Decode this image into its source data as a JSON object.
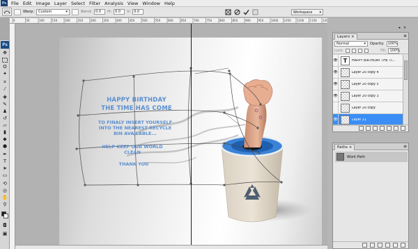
{
  "app": {
    "logo": "Ps"
  },
  "menu": [
    "File",
    "Edit",
    "Image",
    "Layer",
    "Select",
    "Filter",
    "Analysis",
    "View",
    "Window",
    "Help"
  ],
  "options": {
    "warp_label": "Warp:",
    "warp_value": "Custom",
    "bend_label": "Bend:",
    "bend_value": "0.0",
    "h_label": "H:",
    "h_value": "0.0",
    "v_label": "V:",
    "v_value": "0.0",
    "workspace": "Workspace"
  },
  "ruler_ticks": [
    "0",
    "50",
    "100",
    "150",
    "200",
    "250",
    "300",
    "350",
    "400",
    "450",
    "500",
    "550",
    "600",
    "650",
    "700",
    "750",
    "800",
    "850",
    "900",
    "950",
    "1000",
    "1050",
    "1100",
    "1150",
    "1200"
  ],
  "canvas_text": {
    "heading_line1": "HAPPY BIRTHDAY",
    "heading_line2": "THE TIME HAS COME",
    "body_line1": "TO FINALY INSERT YOURSELF",
    "body_line2": "INTO THE NEAREST RECYCLE",
    "body_line3": "BIN AVAILABLE...",
    "help_line1": "HELP KEEP OUR WORLD",
    "help_line2": "CLEAN",
    "thanks": "THANK YOU"
  },
  "layers_panel": {
    "tab": "Layers",
    "blend_mode": "Normal",
    "opacity_label": "Opacity:",
    "opacity_value": "100%",
    "lock_label": "Lock:",
    "fill_label": "Fill:",
    "fill_value": "100%",
    "layers": [
      {
        "name": "HAPPY BIRTHDAY THE TI...",
        "type": "text",
        "visible": true,
        "selected": false
      },
      {
        "name": "Layer 20 copy 4",
        "type": "pixel",
        "visible": true,
        "selected": false
      },
      {
        "name": "Layer 20 copy 5",
        "type": "pixel",
        "visible": true,
        "selected": false
      },
      {
        "name": "Layer 20 copy 3",
        "type": "pixel",
        "visible": true,
        "selected": false
      },
      {
        "name": "Layer 20 copy",
        "type": "pixel",
        "visible": false,
        "selected": false
      },
      {
        "name": "Layer 21",
        "type": "pixel",
        "visible": true,
        "selected": true
      }
    ]
  },
  "paths_panel": {
    "tab": "Paths",
    "items": [
      {
        "name": "Work Path"
      }
    ]
  },
  "colors": {
    "text_blue": "#5b8fd1",
    "selection_blue": "#3a8ef6",
    "bin_rim_blue": "#2f7fd6"
  }
}
